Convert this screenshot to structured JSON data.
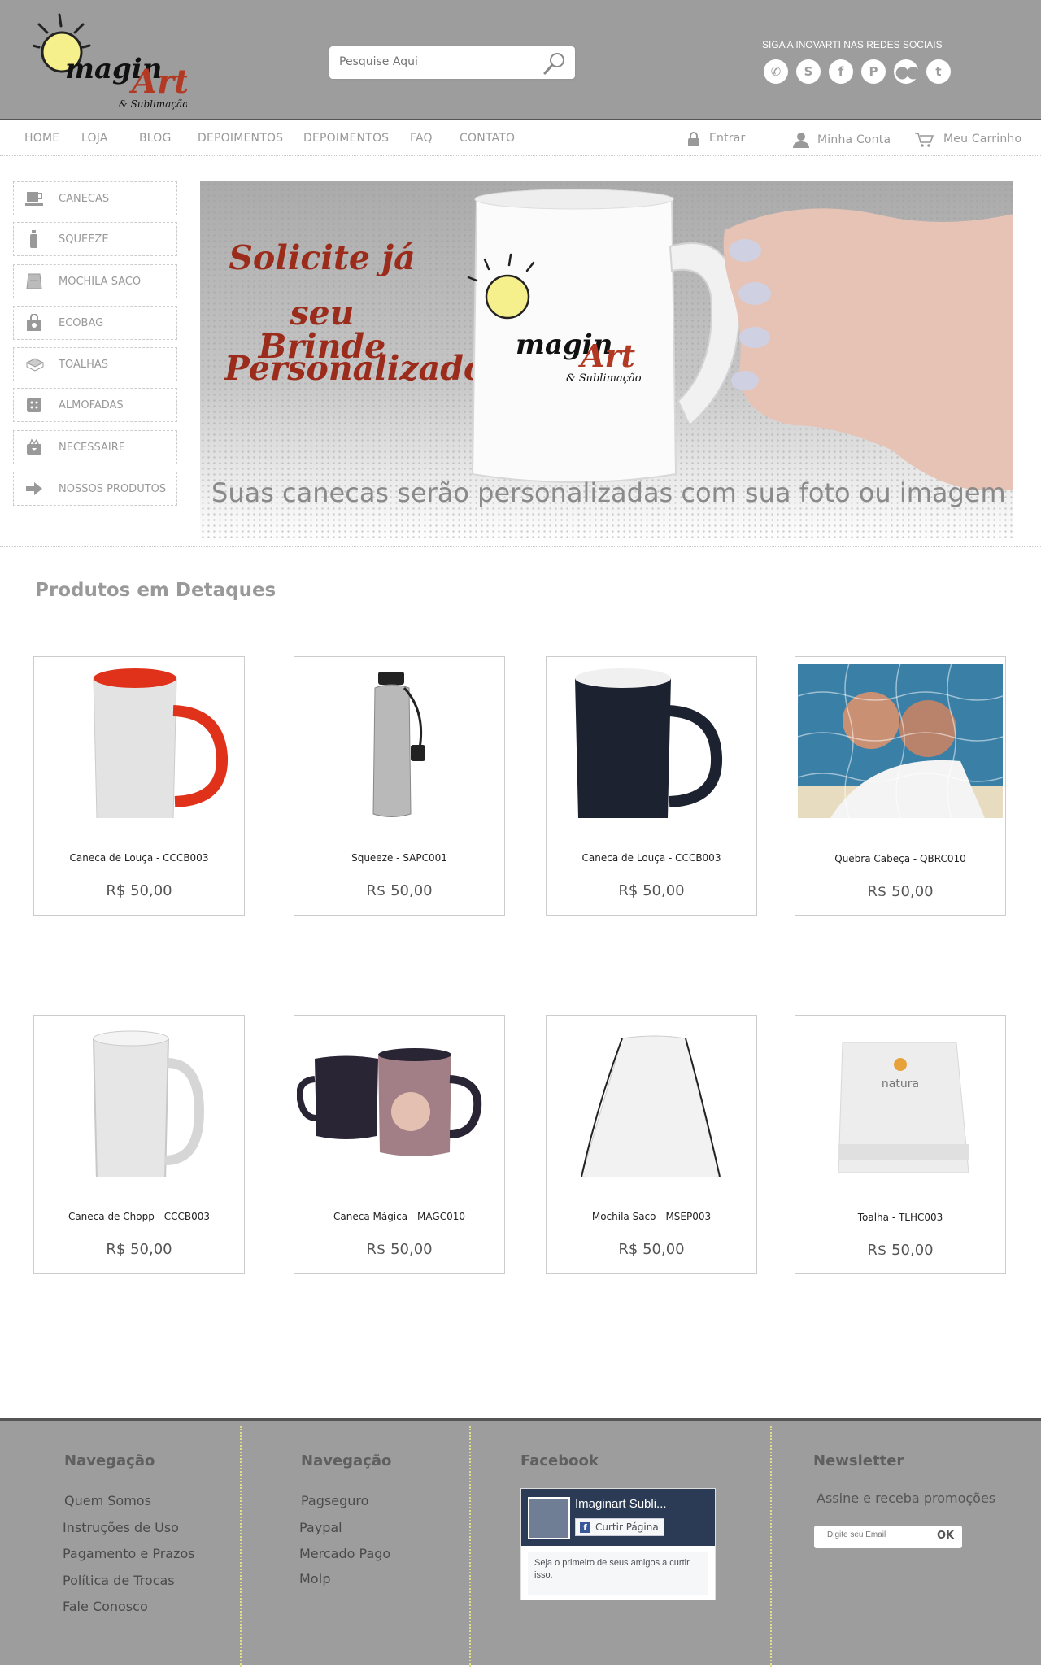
{
  "header": {
    "logo_text": "Imagin Art & Sublimação",
    "search": {
      "placeholder": "Pesquise Aqui"
    },
    "social": {
      "title": "SIGA A INOVARTI NAS REDES SOCIAIS",
      "icons": [
        "whatsapp-icon",
        "skype-icon",
        "facebook-icon",
        "pinterest-icon",
        "flickr-icon",
        "twitter-icon"
      ]
    }
  },
  "nav": {
    "items": [
      "HOME",
      "LOJA",
      "BLOG",
      "DEPOIMENTOS",
      "DEPOIMENTOS",
      "FAQ",
      "CONTATO"
    ],
    "login": "Entrar",
    "account": "Minha Conta",
    "cart": "Meu Carrinho"
  },
  "sidebar": {
    "categories": [
      "CANECAS",
      "SQUEEZE",
      "MOCHILA SACO",
      "ECOBAG",
      "TOALHAS",
      "ALMOFADAS",
      "NECESSAIRE",
      "NOSSOS PRODUTOS"
    ]
  },
  "banner": {
    "headline": [
      "Solicite já",
      "seu Brinde",
      "Personalizado"
    ],
    "subtitle": "Suas canecas serão personalizadas com sua foto ou imagem",
    "logo_text": "Imagin Art & Sublimação"
  },
  "featured": {
    "title": "Produtos em Detaques",
    "products": [
      {
        "name": "Caneca de Louça - CCCB003",
        "price": "R$ 50,00"
      },
      {
        "name": "Squeeze - SAPC001",
        "price": "R$ 50,00"
      },
      {
        "name": "Caneca de Louça - CCCB003",
        "price": "R$ 50,00"
      },
      {
        "name": "Quebra Cabeça - QBRC010",
        "price": "R$ 50,00"
      },
      {
        "name": "Caneca de Chopp - CCCB003",
        "price": "R$ 50,00"
      },
      {
        "name": "Caneca Mágica - MAGC010",
        "price": "R$ 50,00"
      },
      {
        "name": "Mochila Saco - MSEP003",
        "price": "R$ 50,00"
      },
      {
        "name": "Toalha - TLHC003",
        "price": "R$ 50,00"
      }
    ]
  },
  "footer": {
    "nav1": {
      "title": "Navegação",
      "links": [
        "Quem Somos",
        "Instruções de Uso",
        "Pagamento e Prazos",
        "Política de Trocas",
        "Fale Conosco"
      ]
    },
    "nav2": {
      "title": "Navegação",
      "links": [
        "Pagseguro",
        "Paypal",
        "Mercado Pago",
        "MoIp"
      ]
    },
    "facebook": {
      "title": "Facebook",
      "page_name": "Imaginart Subli...",
      "like_button": "Curtir Página",
      "friends_text": "Seja o primeiro de seus amigos a curtir isso."
    },
    "newsletter": {
      "title": "Newsletter",
      "text": "Assine e receba promoções",
      "placeholder": "Digite seu Email",
      "submit": "OK"
    }
  },
  "colors": {
    "header_bg": "#9d9d9d",
    "banner_red": "#9b2c1c",
    "footer_bg": "#9d9d9d"
  }
}
